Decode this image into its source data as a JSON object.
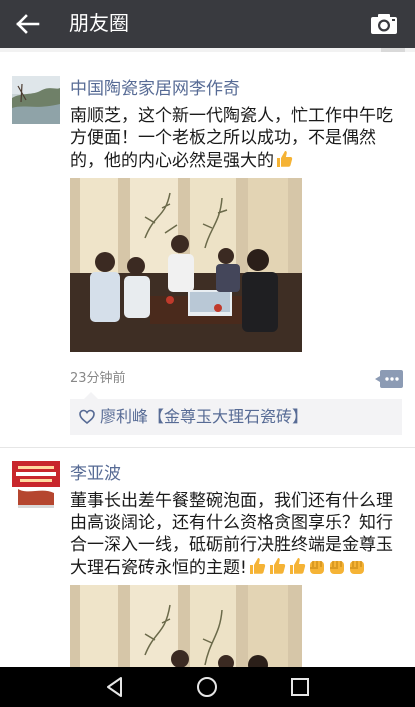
{
  "header": {
    "title": "朋友圈"
  },
  "posts": [
    {
      "author": "中国陶瓷家居网李作奇",
      "text": "南顺芝，这个新一代陶瓷人，忙工作中午吃方便面！一个老板之所以成功，不是偶然的，他的内心必然是强大的",
      "time": "23分钟前",
      "likes": "廖利峰【金尊玉大理石瓷砖】",
      "emoji": [
        "thumbs-up"
      ]
    },
    {
      "author": "李亚波",
      "text": "董事长出差午餐整碗泡面，我们还有什么理由高谈阔论，还有什么资格贪图享乐？知行合一深入一线，砥砺前行决胜终端是金尊玉大理石瓷砖永恒的主题!",
      "emoji": [
        "thumbs-up",
        "thumbs-up",
        "thumbs-up",
        "fist",
        "fist",
        "fist"
      ]
    }
  ],
  "colors": {
    "header": "#393a3f",
    "link": "#576b95",
    "emoji": "#f5b335"
  }
}
